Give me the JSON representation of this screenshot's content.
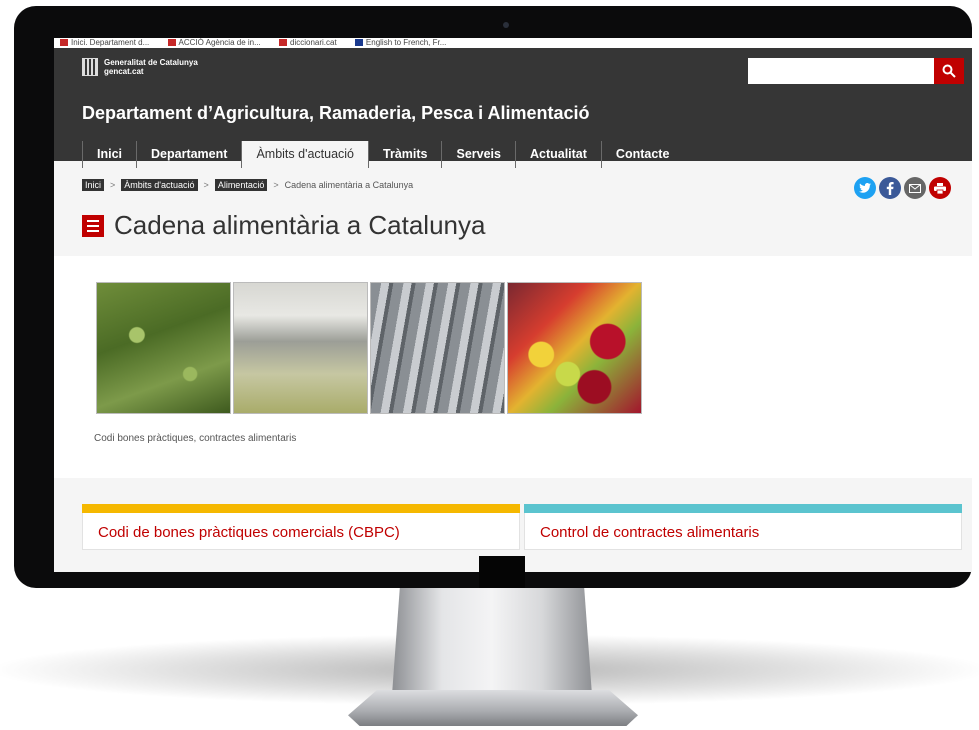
{
  "bookmarks": [
    "Inici. Departament d...",
    "ACCIÓ Agència de in...",
    "diccionari.cat",
    "English to French, Fr..."
  ],
  "header": {
    "logo_line1": "Generalitat de Catalunya",
    "logo_line2": "gencat.cat",
    "search_placeholder": "",
    "department_title": "Departament d’Agricultura, Ramaderia, Pesca i Alimentació"
  },
  "nav": {
    "items": [
      {
        "label": "Inici"
      },
      {
        "label": "Departament"
      },
      {
        "label": "Àmbits d'actuació"
      },
      {
        "label": "Tràmits"
      },
      {
        "label": "Serveis"
      },
      {
        "label": "Actualitat"
      },
      {
        "label": "Contacte"
      }
    ],
    "active": "Àmbits d'actuació"
  },
  "breadcrumb": {
    "items": [
      "Inici",
      "Àmbits d'actuació",
      "Alimentació"
    ],
    "current": "Cadena alimentària a Catalunya",
    "separator": ">"
  },
  "share": {
    "icons": [
      "twitter-icon",
      "facebook-icon",
      "email-icon",
      "print-icon"
    ],
    "colors": [
      "#1da1f2",
      "#3b5998",
      "#666666",
      "#c00000"
    ]
  },
  "page": {
    "title": "Cadena alimentària a Catalunya",
    "caption": "Codi bones pràctiques, contractes alimentaris"
  },
  "cards": [
    {
      "label": "Codi de bones pràctiques comercials (CBPC)",
      "accent": "#f5b800"
    },
    {
      "label": "Control de contractes alimentaris",
      "accent": "#5bc4cf"
    }
  ],
  "colors": {
    "brand_red": "#c00000",
    "header_bg": "#363636"
  }
}
